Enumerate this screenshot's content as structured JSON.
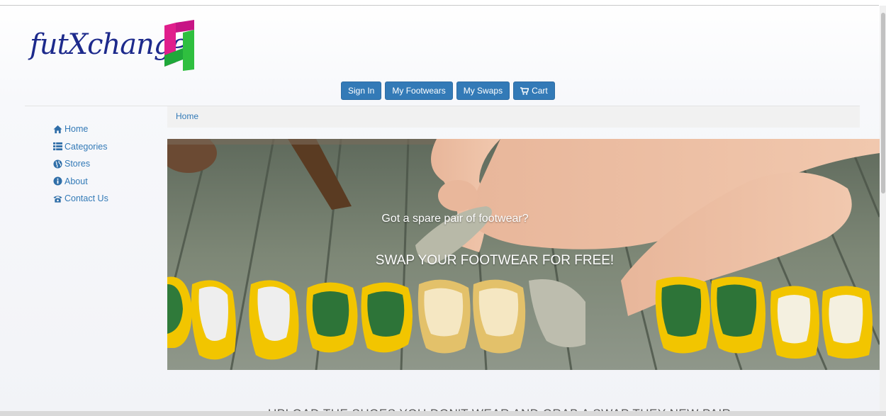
{
  "logo": {
    "text": "futXchange"
  },
  "nav": {
    "sign_in": "Sign In",
    "my_footwears": "My Footwears",
    "my_swaps": "My Swaps",
    "cart": "Cart"
  },
  "sidebar": {
    "items": [
      {
        "label": "Home",
        "icon": "home-icon"
      },
      {
        "label": "Categories",
        "icon": "list-icon"
      },
      {
        "label": "Stores",
        "icon": "globe-icon"
      },
      {
        "label": "About",
        "icon": "info-icon"
      },
      {
        "label": "Contact Us",
        "icon": "phone-icon"
      }
    ]
  },
  "breadcrumb": {
    "current": "Home"
  },
  "hero": {
    "line1": "Got a spare pair of footwear?",
    "line2": "SWAP YOUR FOOTWEAR FOR FREE!"
  },
  "colors": {
    "primary": "#337ab7",
    "logo_text": "#1d2a8c",
    "shoe_yellow": "#f2c500"
  },
  "bottom": {
    "text": "UPLOAD THE SHOES YOU DON'T WEAR AND GRAB A SWAP THEY NEW PAIR"
  }
}
